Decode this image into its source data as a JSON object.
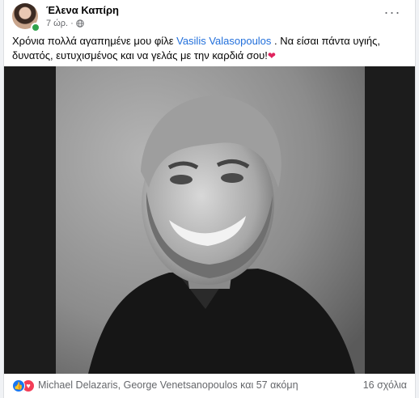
{
  "post": {
    "author": "Έλενα Καπίρη",
    "time": "7 ώρ.",
    "text_before": "Χρόνια πολλά αγαπημένε μου φίλε ",
    "mention": "Vasilis Valasopoulos",
    "text_after": " . Να είσαι πάντα υγιής, δυνατός, ευτυχισμένος και να γελάς με την καρδιά σου!",
    "emoji": "❤"
  },
  "footer": {
    "reactors": "Michael Delazaris, George Venetsanopoulos και 57 ακόμη",
    "comments": "16 σχόλια"
  },
  "icons": {
    "more": "more-options-icon",
    "globe": "globe-icon",
    "like": "like-reaction-icon",
    "love": "love-reaction-icon"
  },
  "colors": {
    "mention": "#216fdb",
    "like": "#1877f2",
    "love": "#f33e58",
    "online": "#31a24c"
  }
}
